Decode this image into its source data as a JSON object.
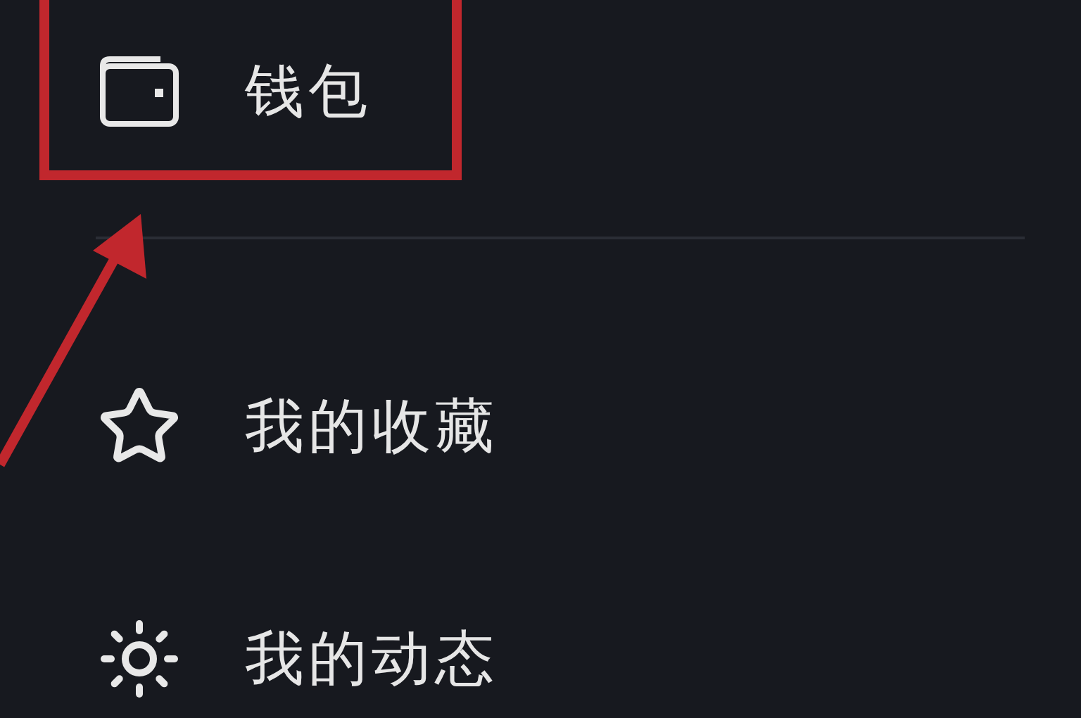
{
  "menu": {
    "items": [
      {
        "kind": "wallet",
        "label": "钱包",
        "highlighted": true
      },
      {
        "kind": "star",
        "label": "我的收藏",
        "highlighted": false
      },
      {
        "kind": "sun",
        "label": "我的动态",
        "highlighted": false
      }
    ]
  }
}
